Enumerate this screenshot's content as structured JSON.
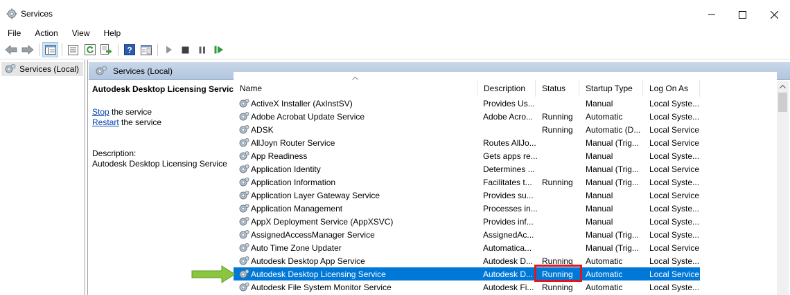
{
  "window": {
    "title": "Services",
    "icons": {
      "app": "services-gear-icon",
      "minimize": "minimize-icon",
      "maximize": "maximize-icon",
      "close": "close-icon"
    }
  },
  "menu": [
    "File",
    "Action",
    "View",
    "Help"
  ],
  "toolbar": {
    "buttons": [
      "back-arrow-icon",
      "forward-arrow-icon",
      "show-hide-tree-icon",
      "properties-icon",
      "refresh-icon",
      "export-list-icon",
      "help-icon",
      "details-view-icon",
      "start-service-icon",
      "stop-service-icon",
      "pause-service-icon",
      "restart-service-icon"
    ]
  },
  "tree": {
    "root_label": "Services (Local)"
  },
  "pane_header": {
    "label": "Services (Local)"
  },
  "details": {
    "title": "Autodesk Desktop Licensing Service",
    "stop_link": "Stop",
    "stop_rest": " the service",
    "restart_link": "Restart",
    "restart_rest": " the service",
    "description_label": "Description:",
    "description_text": "Autodesk Desktop Licensing Service"
  },
  "columns": {
    "name": "Name",
    "description": "Description",
    "status": "Status",
    "startup": "Startup Type",
    "logon": "Log On As"
  },
  "rows": [
    {
      "name": "ActiveX Installer (AxInstSV)",
      "description": "Provides Us...",
      "status": "",
      "startup": "Manual",
      "logon": "Local Syste..."
    },
    {
      "name": "Adobe Acrobat Update Service",
      "description": "Adobe Acro...",
      "status": "Running",
      "startup": "Automatic",
      "logon": "Local Syste..."
    },
    {
      "name": "ADSK",
      "description": "",
      "status": "Running",
      "startup": "Automatic (D...",
      "logon": "Local Service"
    },
    {
      "name": "AllJoyn Router Service",
      "description": "Routes AllJo...",
      "status": "",
      "startup": "Manual (Trig...",
      "logon": "Local Service"
    },
    {
      "name": "App Readiness",
      "description": "Gets apps re...",
      "status": "",
      "startup": "Manual",
      "logon": "Local Syste..."
    },
    {
      "name": "Application Identity",
      "description": "Determines ...",
      "status": "",
      "startup": "Manual (Trig...",
      "logon": "Local Service"
    },
    {
      "name": "Application Information",
      "description": "Facilitates t...",
      "status": "Running",
      "startup": "Manual (Trig...",
      "logon": "Local Syste..."
    },
    {
      "name": "Application Layer Gateway Service",
      "description": "Provides su...",
      "status": "",
      "startup": "Manual",
      "logon": "Local Service"
    },
    {
      "name": "Application Management",
      "description": "Processes in...",
      "status": "",
      "startup": "Manual",
      "logon": "Local Syste..."
    },
    {
      "name": "AppX Deployment Service (AppXSVC)",
      "description": "Provides inf...",
      "status": "",
      "startup": "Manual",
      "logon": "Local Syste..."
    },
    {
      "name": "AssignedAccessManager Service",
      "description": "AssignedAc...",
      "status": "",
      "startup": "Manual (Trig...",
      "logon": "Local Syste..."
    },
    {
      "name": "Auto Time Zone Updater",
      "description": "Automatica...",
      "status": "",
      "startup": "Manual (Trig...",
      "logon": "Local Service"
    },
    {
      "name": "Autodesk Desktop App Service",
      "description": "Autodesk D...",
      "status": "Running",
      "startup": "Automatic",
      "logon": "Local Syste..."
    },
    {
      "name": "Autodesk Desktop Licensing Service",
      "description": "Autodesk D...",
      "status": "Running",
      "startup": "Automatic",
      "logon": "Local Service",
      "selected": true
    },
    {
      "name": "Autodesk File System Monitor Service",
      "description": "Autodesk Fi...",
      "status": "Running",
      "startup": "Automatic",
      "logon": "Local Syste..."
    }
  ],
  "annotations": {
    "highlight_color": "#e0161e",
    "arrow_color": "#7cbf3a",
    "selection_color": "#0078d7"
  }
}
